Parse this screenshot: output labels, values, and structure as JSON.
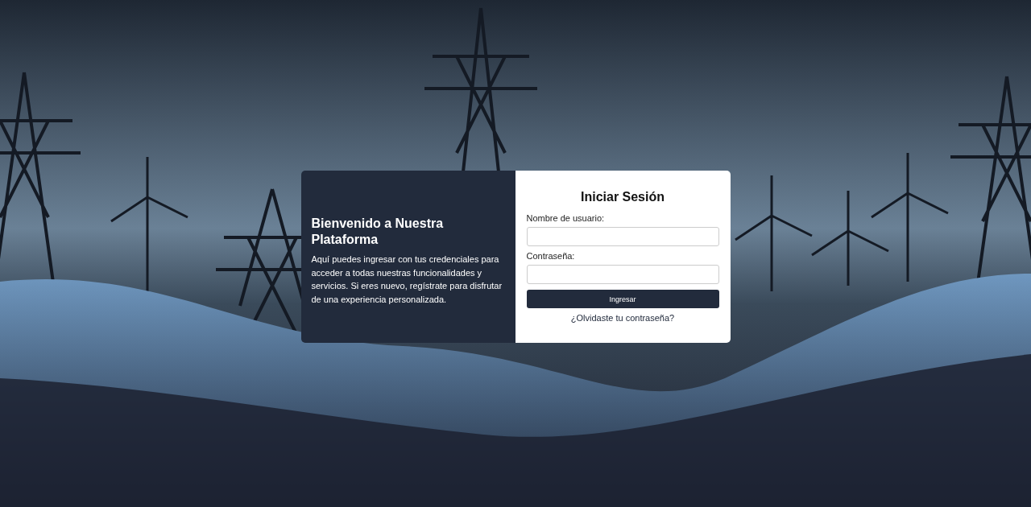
{
  "welcome": {
    "title": "Bienvenido a Nuestra Plataforma",
    "text": "Aquí puedes ingresar con tus credenciales para acceder a todas nuestras funcionalidades y servicios. Si eres nuevo, regístrate para disfrutar de una experiencia personalizada."
  },
  "login": {
    "title": "Iniciar Sesión",
    "fields": [
      {
        "label": "Nombre de usuario:"
      },
      {
        "label": "Contraseña:"
      }
    ],
    "button": "Ingresar",
    "forgot_link": "¿Olvidaste tu contraseña?"
  }
}
